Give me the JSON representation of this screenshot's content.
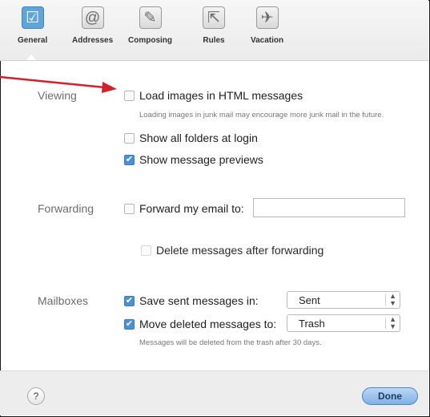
{
  "toolbar": {
    "tabs": [
      {
        "label": "General",
        "icon": "checkbox-icon",
        "selected": true
      },
      {
        "label": "Addresses",
        "icon": "at-sign-icon",
        "selected": false
      },
      {
        "label": "Composing",
        "icon": "compose-icon",
        "selected": false
      },
      {
        "label": "Rules",
        "icon": "rules-icon",
        "selected": false
      },
      {
        "label": "Vacation",
        "icon": "airplane-icon",
        "selected": false
      }
    ]
  },
  "viewing": {
    "label": "Viewing",
    "load_images": {
      "label": "Load images in HTML messages",
      "checked": false
    },
    "load_images_hint": "Loading images in junk mail may encourage more junk mail in the future.",
    "show_folders": {
      "label": "Show all folders at login",
      "checked": false
    },
    "show_previews": {
      "label": "Show message previews",
      "checked": true
    }
  },
  "forwarding": {
    "label": "Forwarding",
    "forward": {
      "label": "Forward my email to:",
      "checked": false,
      "value": ""
    },
    "delete_after": {
      "label": "Delete messages after forwarding",
      "checked": false,
      "disabled": true
    }
  },
  "mailboxes": {
    "label": "Mailboxes",
    "save_sent": {
      "label": "Save sent messages in:",
      "checked": true,
      "selected": "Sent"
    },
    "move_deleted": {
      "label": "Move deleted messages to:",
      "checked": true,
      "selected": "Trash"
    },
    "hint": "Messages will be deleted from the trash after 30 days."
  },
  "footer": {
    "help_label": "?",
    "done_label": "Done"
  },
  "colors": {
    "accent": "#4a90d6",
    "annotation_arrow": "#d0202a"
  }
}
